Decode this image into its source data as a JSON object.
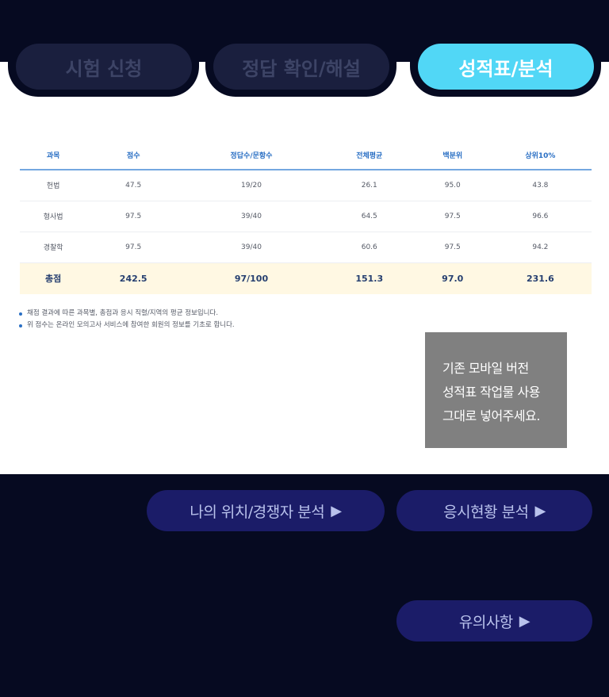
{
  "tabs": [
    {
      "label": "시험 신청",
      "active": false
    },
    {
      "label": "정답 확인/해설",
      "active": false
    },
    {
      "label": "성적표/분석",
      "active": true
    }
  ],
  "table": {
    "headers": [
      "과목",
      "점수",
      "정답수/문항수",
      "전체평균",
      "백분위",
      "상위10%"
    ],
    "rows": [
      [
        "헌법",
        "47.5",
        "19/20",
        "26.1",
        "95.0",
        "43.8"
      ],
      [
        "형사법",
        "97.5",
        "39/40",
        "64.5",
        "97.5",
        "96.6"
      ],
      [
        "경찰학",
        "97.5",
        "39/40",
        "60.6",
        "97.5",
        "94.2"
      ]
    ],
    "total": [
      "총점",
      "242.5",
      "97/100",
      "151.3",
      "97.0",
      "231.6"
    ]
  },
  "notes": [
    "채점 결과에 따른 과목별, 총점과 응시 직렬/지역의 평균 정보입니다.",
    "위 점수는 온라인 모의고사 서비스에 참여한 회원의 정보를 기초로 합니다."
  ],
  "memo": {
    "lines": [
      "기존 모바일 버전",
      "성적표 작업물 사용",
      "그대로 넣어주세요."
    ]
  },
  "buttons": {
    "position": "나의 위치/경쟁자 분석",
    "status": "응시현황 분석",
    "caution": "유의사항",
    "arrow": "▶"
  },
  "colors": {
    "background": "#060a21",
    "tab_active": "#51d7f6",
    "tab_inactive": "#1a1f3e",
    "button": "#1b1c68",
    "table_header_text": "#2a6fc4",
    "total_row_bg": "#fff8e3"
  }
}
